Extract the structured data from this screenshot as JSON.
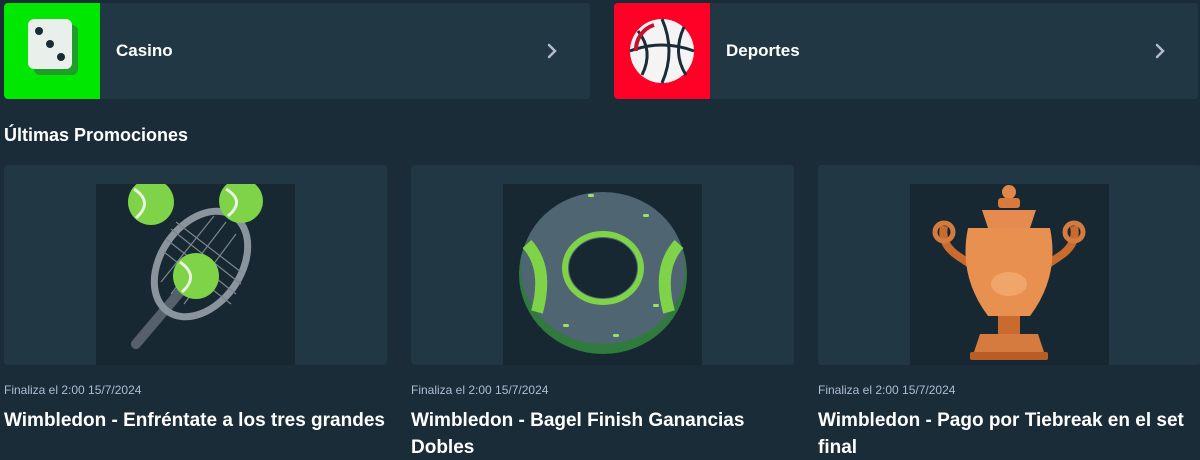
{
  "categories": [
    {
      "label": "Casino",
      "icon": "dice-icon",
      "color": "#00e701"
    },
    {
      "label": "Deportes",
      "icon": "basketball-icon",
      "color": "#ff0026"
    }
  ],
  "section_title": "Últimas Promociones",
  "promotions": [
    {
      "ends": "Finaliza el 2:00 15/7/2024",
      "title": "Wimbledon - Enfréntate a los tres grandes",
      "icon": "tennis-racket-icon"
    },
    {
      "ends": "Finaliza el 2:00 15/7/2024",
      "title": "Wimbledon - Bagel Finish Ganancias Dobles",
      "icon": "bagel-tennis-ball-icon"
    },
    {
      "ends": "Finaliza el 2:00 15/7/2024",
      "title": "Wimbledon - Pago por Tiebreak en el set final",
      "icon": "trophy-icon"
    }
  ]
}
